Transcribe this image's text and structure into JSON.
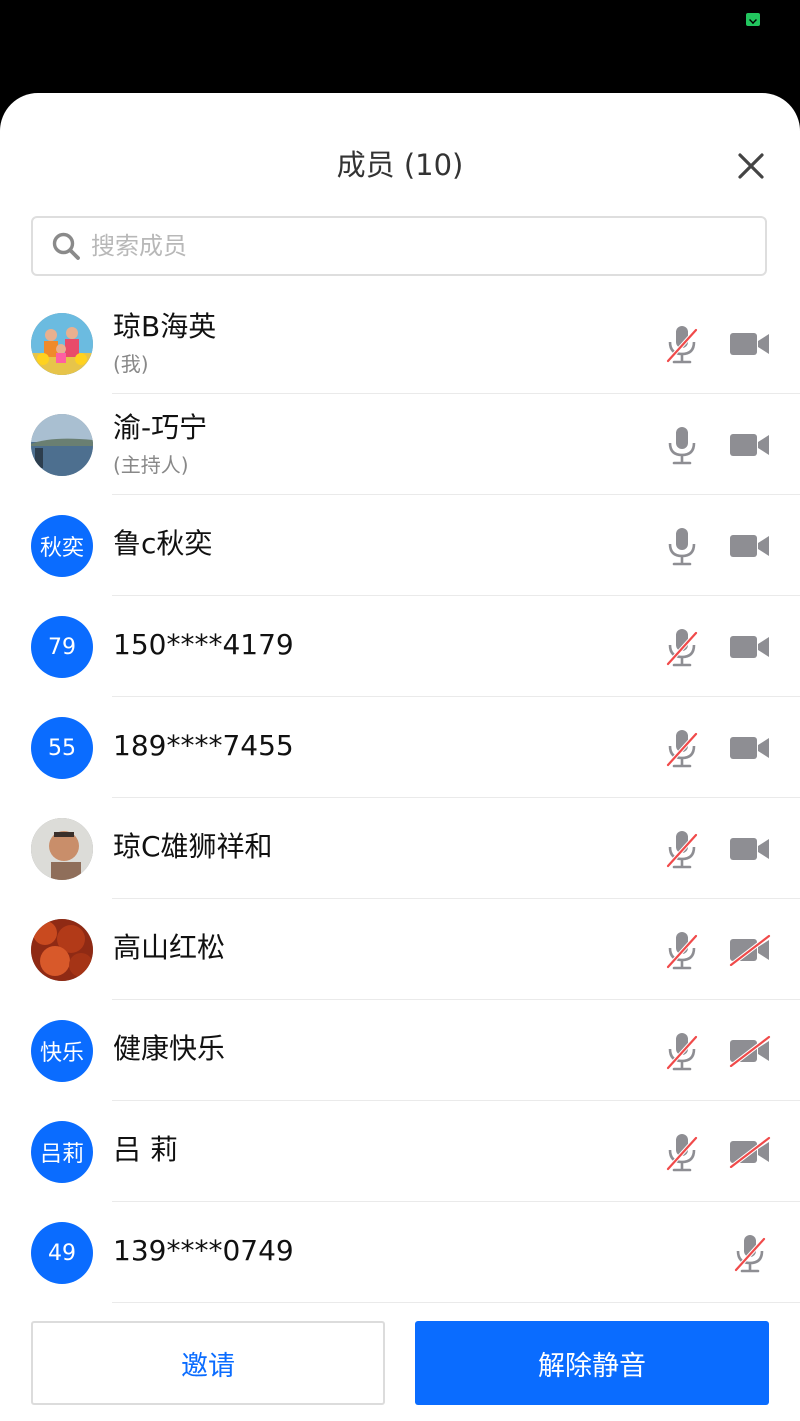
{
  "header": {
    "title": "成员 (10)",
    "close_icon": "close-icon"
  },
  "search": {
    "placeholder": "搜索成员",
    "value": ""
  },
  "colors": {
    "accent": "#0a6cff",
    "icon_gray": "#8e8e93",
    "mute_slash": "#f04a4a"
  },
  "members": [
    {
      "name": "琼B海英",
      "role": "(我)",
      "avatar": "photo-family",
      "mic_muted": true,
      "cam_off": false,
      "has_cam": true
    },
    {
      "name": "渝-巧宁",
      "role": "(主持人)",
      "avatar": "photo-landscape",
      "mic_muted": false,
      "cam_off": false,
      "has_cam": true
    },
    {
      "name": "鲁c秋奕",
      "avatar_text": "秋奕",
      "mic_muted": false,
      "cam_off": false,
      "has_cam": true
    },
    {
      "name": "150****4179",
      "avatar_text": "79",
      "mic_muted": true,
      "cam_off": false,
      "has_cam": true
    },
    {
      "name": "189****7455",
      "avatar_text": "55",
      "mic_muted": true,
      "cam_off": false,
      "has_cam": true
    },
    {
      "name": "琼C雄狮祥和",
      "avatar": "photo-man",
      "mic_muted": true,
      "cam_off": false,
      "has_cam": true
    },
    {
      "name": "高山红松",
      "avatar": "photo-red-leaves",
      "mic_muted": true,
      "cam_off": true,
      "has_cam": true
    },
    {
      "name": "健康快乐",
      "avatar_text": "快乐",
      "mic_muted": true,
      "cam_off": true,
      "has_cam": true
    },
    {
      "name": "吕 莉",
      "avatar_text": "吕莉",
      "mic_muted": true,
      "cam_off": true,
      "has_cam": true
    },
    {
      "name": "139****0749",
      "avatar_text": "49",
      "mic_muted": true,
      "has_cam": false
    }
  ],
  "footer": {
    "invite_label": "邀请",
    "unmute_all_label": "解除静音"
  }
}
